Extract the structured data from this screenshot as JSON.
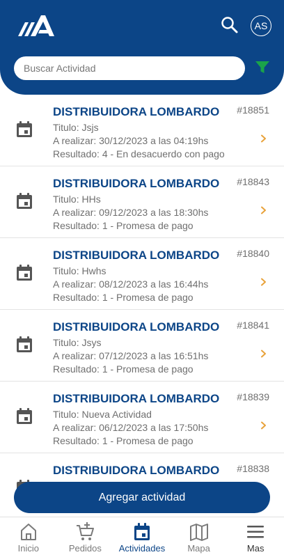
{
  "header": {
    "logo_icon": "brand-logo",
    "search_icon": "search-icon",
    "avatar_initials": "AS",
    "search_placeholder": "Buscar Actividad",
    "filter_icon": "filter-icon"
  },
  "colors": {
    "primary": "#0c4587",
    "filter": "#1aa34a",
    "chevron": "#e8a23a",
    "secondary_text": "#6f6f6f"
  },
  "activities": [
    {
      "company": "DISTRIBUIDORA LOMBARDO",
      "number": "#18851",
      "titulo": "Titulo: Jsjs",
      "fecha": "A realizar: 30/12/2023 a las 04:19hs",
      "resultado": "Resultado: 4 - En desacuerdo con pago"
    },
    {
      "company": "DISTRIBUIDORA LOMBARDO",
      "number": "#18843",
      "titulo": "Titulo: HHs",
      "fecha": "A realizar: 09/12/2023 a las 18:30hs",
      "resultado": "Resultado: 1 - Promesa de pago"
    },
    {
      "company": "DISTRIBUIDORA LOMBARDO",
      "number": "#18840",
      "titulo": "Titulo: Hwhs",
      "fecha": "A realizar: 08/12/2023 a las 16:44hs",
      "resultado": "Resultado: 1 - Promesa de pago"
    },
    {
      "company": "DISTRIBUIDORA LOMBARDO",
      "number": "#18841",
      "titulo": "Titulo: Jsys",
      "fecha": "A realizar: 07/12/2023 a las 16:51hs",
      "resultado": "Resultado: 1 - Promesa de pago"
    },
    {
      "company": "DISTRIBUIDORA LOMBARDO",
      "number": "#18839",
      "titulo": "Titulo: Nueva Actividad",
      "fecha": "A realizar: 06/12/2023 a las 17:50hs",
      "resultado": "Resultado: 1 - Promesa de pago"
    },
    {
      "company": "DISTRIBUIDORA LOMBARDO",
      "number": "#18838",
      "titulo": "",
      "fecha": "",
      "resultado": ""
    }
  ],
  "add_button_label": "Agregar actividad",
  "tabs": [
    {
      "label": "Inicio",
      "icon": "home-icon"
    },
    {
      "label": "Pedidos",
      "icon": "cart-plus-icon"
    },
    {
      "label": "Actividades",
      "icon": "calendar-icon"
    },
    {
      "label": "Mapa",
      "icon": "map-icon"
    },
    {
      "label": "Mas",
      "icon": "menu-icon"
    }
  ]
}
